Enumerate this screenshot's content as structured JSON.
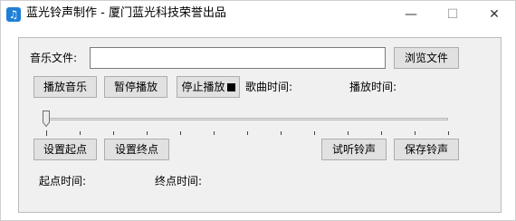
{
  "window": {
    "title": "蓝光铃声制作 - 厦门蓝光科技荣誉出品",
    "icon": "music-note-icon",
    "controls": {
      "minimize": "—",
      "maximize": "☐",
      "close": "✕"
    }
  },
  "file_row": {
    "label": "音乐文件:",
    "value": "",
    "browse": "浏览文件"
  },
  "playback_row": {
    "play": "播放音乐",
    "pause": "暂停播放",
    "stop": "停止播放",
    "song_time": "歌曲时间:",
    "play_time": "播放时间:"
  },
  "slider": {
    "position": 0,
    "tick_count": 13
  },
  "range_row": {
    "set_start": "设置起点",
    "set_end": "设置终点",
    "preview": "试听铃声",
    "save": "保存铃声"
  },
  "times_row": {
    "start_time": "起点时间:",
    "end_time": "终点时间:"
  },
  "colors": {
    "panel_bg": "#f0f0f0",
    "button_bg": "#e1e1e1",
    "button_border": "#adadad",
    "app_icon": "#1e7fd6"
  }
}
